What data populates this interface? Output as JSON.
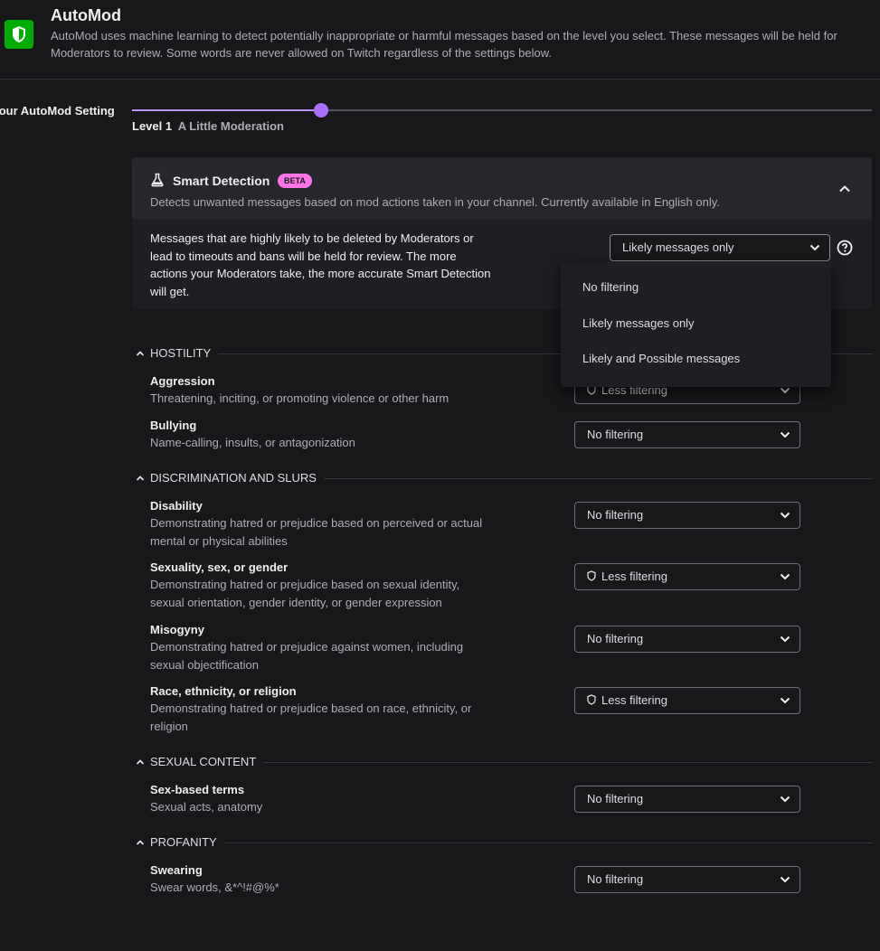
{
  "header": {
    "title": "AutoMod",
    "description": "AutoMod uses machine learning to detect potentially inappropriate or harmful messages based on the level you select. These messages will be held for Moderators to review. Some words are never allowed on Twitch regardless of the settings below."
  },
  "setting": {
    "label": "Your AutoMod Setting",
    "level_label": "Level 1",
    "level_desc": "A Little Moderation",
    "slider_fraction": 0.255
  },
  "smart_detection": {
    "title": "Smart Detection",
    "badge": "BETA",
    "description": "Detects unwanted messages based on mod actions taken in your channel. Currently available in English only.",
    "body": "Messages that are highly likely to be deleted by Moderators or lead to timeouts and bans will be held for review. The more actions your Moderators take, the more accurate Smart Detection will get.",
    "selected": "Likely messages only",
    "options": [
      "No filtering",
      "Likely messages only",
      "Likely and Possible messages"
    ]
  },
  "sections": [
    {
      "title": "HOSTILITY",
      "categories": [
        {
          "title": "Aggression",
          "desc": "Threatening, inciting, or promoting violence or other harm",
          "value": "Less filtering",
          "shield": true
        },
        {
          "title": "Bullying",
          "desc": "Name-calling, insults, or antagonization",
          "value": "No filtering",
          "shield": false
        }
      ]
    },
    {
      "title": "DISCRIMINATION AND SLURS",
      "categories": [
        {
          "title": "Disability",
          "desc": "Demonstrating hatred or prejudice based on perceived or actual mental or physical abilities",
          "value": "No filtering",
          "shield": false
        },
        {
          "title": "Sexuality, sex, or gender",
          "desc": "Demonstrating hatred or prejudice based on sexual identity, sexual orientation, gender identity, or gender expression",
          "value": "Less filtering",
          "shield": true
        },
        {
          "title": "Misogyny",
          "desc": "Demonstrating hatred or prejudice against women, including sexual objectification",
          "value": "No filtering",
          "shield": false
        },
        {
          "title": "Race, ethnicity, or religion",
          "desc": "Demonstrating hatred or prejudice based on race, ethnicity, or religion",
          "value": "Less filtering",
          "shield": true
        }
      ]
    },
    {
      "title": "SEXUAL CONTENT",
      "categories": [
        {
          "title": "Sex-based terms",
          "desc": "Sexual acts, anatomy",
          "value": "No filtering",
          "shield": false
        }
      ]
    },
    {
      "title": "PROFANITY",
      "categories": [
        {
          "title": "Swearing",
          "desc": "Swear words, &*^!#@%*",
          "value": "No filtering",
          "shield": false
        }
      ]
    }
  ],
  "colors": {
    "accent": "#a970ff",
    "shield_green": "#00ad03",
    "beta_pink": "#ff75e6",
    "background": "#18181b"
  }
}
